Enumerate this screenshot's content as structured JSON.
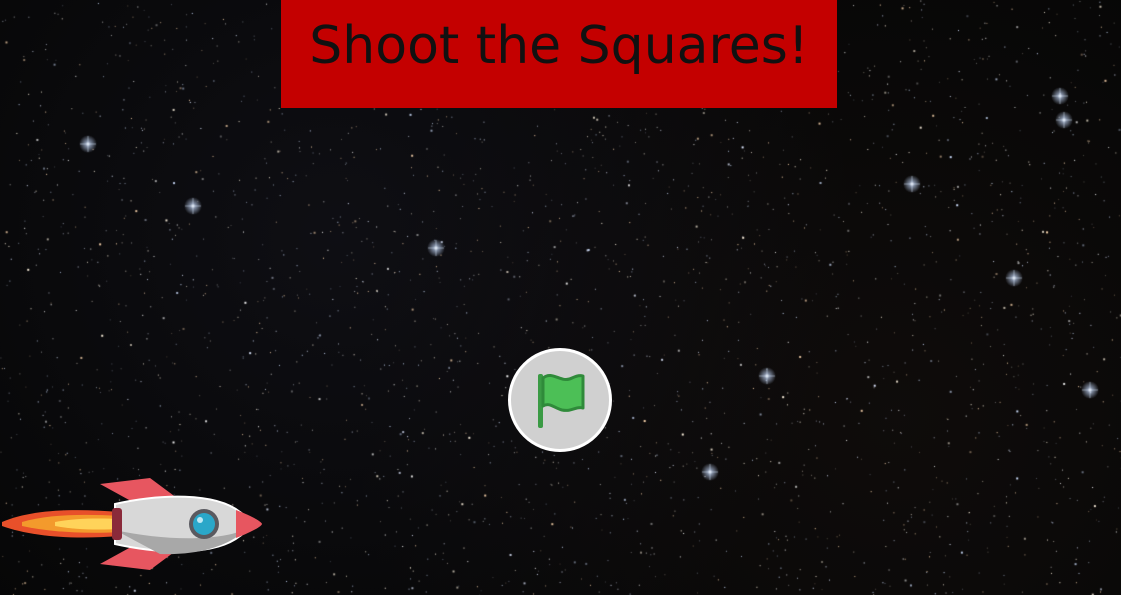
{
  "game": {
    "title": "Shoot the Squares!",
    "colors": {
      "banner": "#c40000",
      "title_text": "#111111",
      "flag_button_bg": "#d0d0d0",
      "flag": "#4cbf56",
      "background": "#060606"
    },
    "start_button": {
      "icon": "green-flag-icon"
    },
    "player": {
      "sprite": "rocket-icon"
    }
  }
}
